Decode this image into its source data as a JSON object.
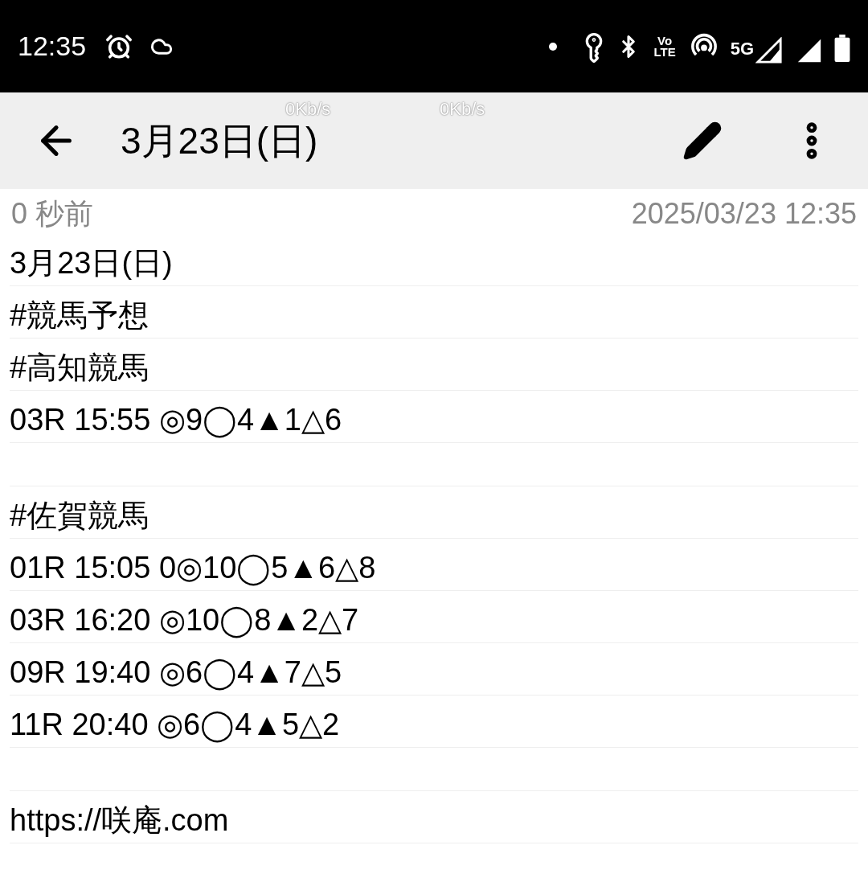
{
  "status_bar": {
    "time": "12:35",
    "volte_top": "Vo",
    "volte_bottom": "LTE",
    "network": "5G"
  },
  "speed_overlays": [
    "0Kb/s",
    "0Kb/s"
  ],
  "toolbar": {
    "title": "3月23日(日)"
  },
  "meta": {
    "edited": "0 秒前",
    "timestamp": "2025/03/23 12:35"
  },
  "lines": [
    {
      "kind": "text",
      "text": "3月23日(日)"
    },
    {
      "kind": "text",
      "text": "#競馬予想"
    },
    {
      "kind": "text",
      "text": "#高知競馬"
    },
    {
      "kind": "text",
      "text": "03R 15:55 ◎9◯4▲1△6"
    },
    {
      "kind": "blank"
    },
    {
      "kind": "text",
      "text": "#佐賀競馬"
    },
    {
      "kind": "text",
      "text": "01R 15:05 0◎10◯5▲6△8"
    },
    {
      "kind": "text",
      "text": "03R 16:20 ◎10◯8▲2△7"
    },
    {
      "kind": "text",
      "text": "09R 19:40 ◎6◯4▲7△5"
    },
    {
      "kind": "text",
      "text": "11R 20:40 ◎6◯4▲5△2"
    },
    {
      "kind": "blank"
    },
    {
      "kind": "text",
      "text": "https://咲庵.com"
    }
  ]
}
